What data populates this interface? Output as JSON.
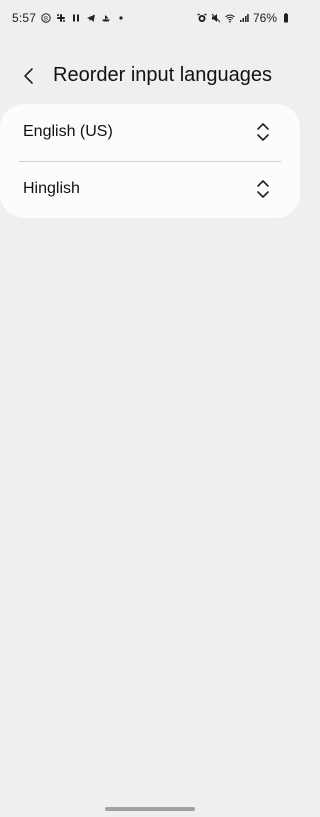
{
  "status_bar": {
    "time": "5:57",
    "battery": "76%",
    "left_icons": [
      "b-circle-icon",
      "slack-icon",
      "pause-icon",
      "telegram-icon",
      "boat-icon",
      "dot-icon"
    ],
    "right_icons": [
      "alarm-icon",
      "mute-icon",
      "wifi-icon",
      "signal-icon",
      "battery-icon"
    ]
  },
  "header": {
    "title": "Reorder input languages"
  },
  "languages": [
    {
      "label": "English (US)"
    },
    {
      "label": "Hinglish"
    }
  ]
}
